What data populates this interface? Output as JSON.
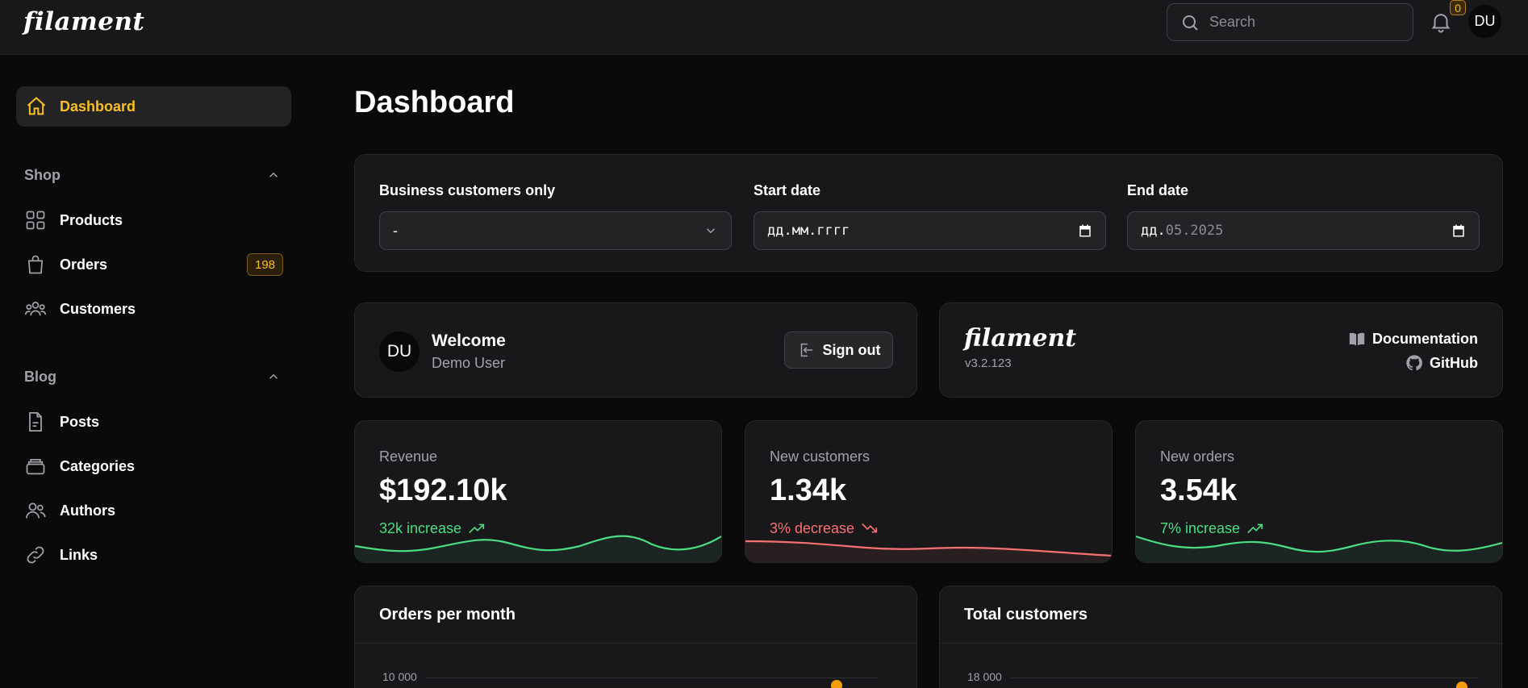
{
  "app": {
    "logo": "filament"
  },
  "topbar": {
    "search_placeholder": "Search",
    "notifications_count": "0",
    "user_initials": "DU"
  },
  "sidebar": {
    "dashboard_label": "Dashboard",
    "groups": [
      {
        "label": "Shop",
        "items": [
          {
            "label": "Products",
            "icon": "squares-icon"
          },
          {
            "label": "Orders",
            "icon": "shopping-bag-icon",
            "badge": "198"
          },
          {
            "label": "Customers",
            "icon": "users-icon"
          }
        ]
      },
      {
        "label": "Blog",
        "items": [
          {
            "label": "Posts",
            "icon": "document-icon"
          },
          {
            "label": "Categories",
            "icon": "rectangle-stack-icon"
          },
          {
            "label": "Authors",
            "icon": "user-group-icon"
          },
          {
            "label": "Links",
            "icon": "link-icon"
          }
        ]
      }
    ]
  },
  "main": {
    "title": "Dashboard",
    "filters": {
      "business": {
        "label": "Business customers only",
        "value": "-"
      },
      "start": {
        "label": "Start date",
        "value": "дд.мм.гггг"
      },
      "end": {
        "label": "End date",
        "value_prefix": "дд.",
        "value_rest": "05.2025"
      }
    },
    "welcome": {
      "initials": "DU",
      "title": "Welcome",
      "name": "Demo User",
      "signout": "Sign out"
    },
    "filament_info": {
      "logo": "filament",
      "version": "v3.2.123",
      "documentation": "Documentation",
      "github": "GitHub"
    },
    "stats": [
      {
        "label": "Revenue",
        "value": "$192.10k",
        "desc": "32k increase",
        "trend": "up",
        "color": "#4ade80"
      },
      {
        "label": "New customers",
        "value": "1.34k",
        "desc": "3% decrease",
        "trend": "down",
        "color": "#f87171"
      },
      {
        "label": "New orders",
        "value": "3.54k",
        "desc": "7% increase",
        "trend": "up",
        "color": "#4ade80"
      }
    ],
    "charts": [
      {
        "title": "Orders per month",
        "top_tick": "10 000"
      },
      {
        "title": "Total customers",
        "top_tick": "18 000"
      }
    ]
  },
  "colors": {
    "accent": "#fbbf24",
    "success": "#4ade80",
    "danger": "#f87171",
    "background": "#0a0a0b",
    "card": "#18181b"
  }
}
